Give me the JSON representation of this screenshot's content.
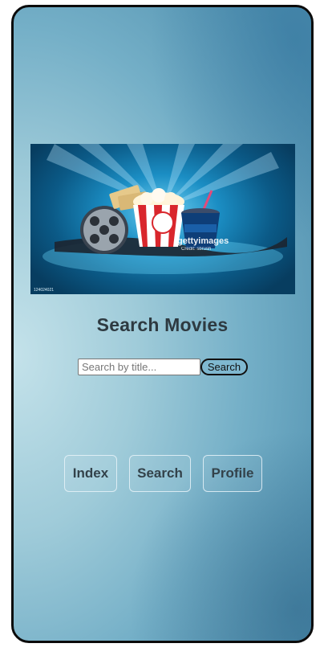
{
  "hero": {
    "image_name": "movie-theater-stock-image",
    "watermark_text": "gettyimages",
    "watermark_credit": "Credit: sbrush",
    "image_id": "124024021"
  },
  "page": {
    "title": "Search Movies"
  },
  "search": {
    "placeholder": "Search by title...",
    "value": "",
    "button_label": "Search"
  },
  "nav": {
    "items": [
      {
        "label": "Index"
      },
      {
        "label": "Search"
      },
      {
        "label": "Profile"
      }
    ]
  },
  "colors": {
    "frame": "#0b0b0b",
    "title": "#2e3a41",
    "nav_text": "#33424a",
    "search_button_bg": "#7fb8d0"
  }
}
